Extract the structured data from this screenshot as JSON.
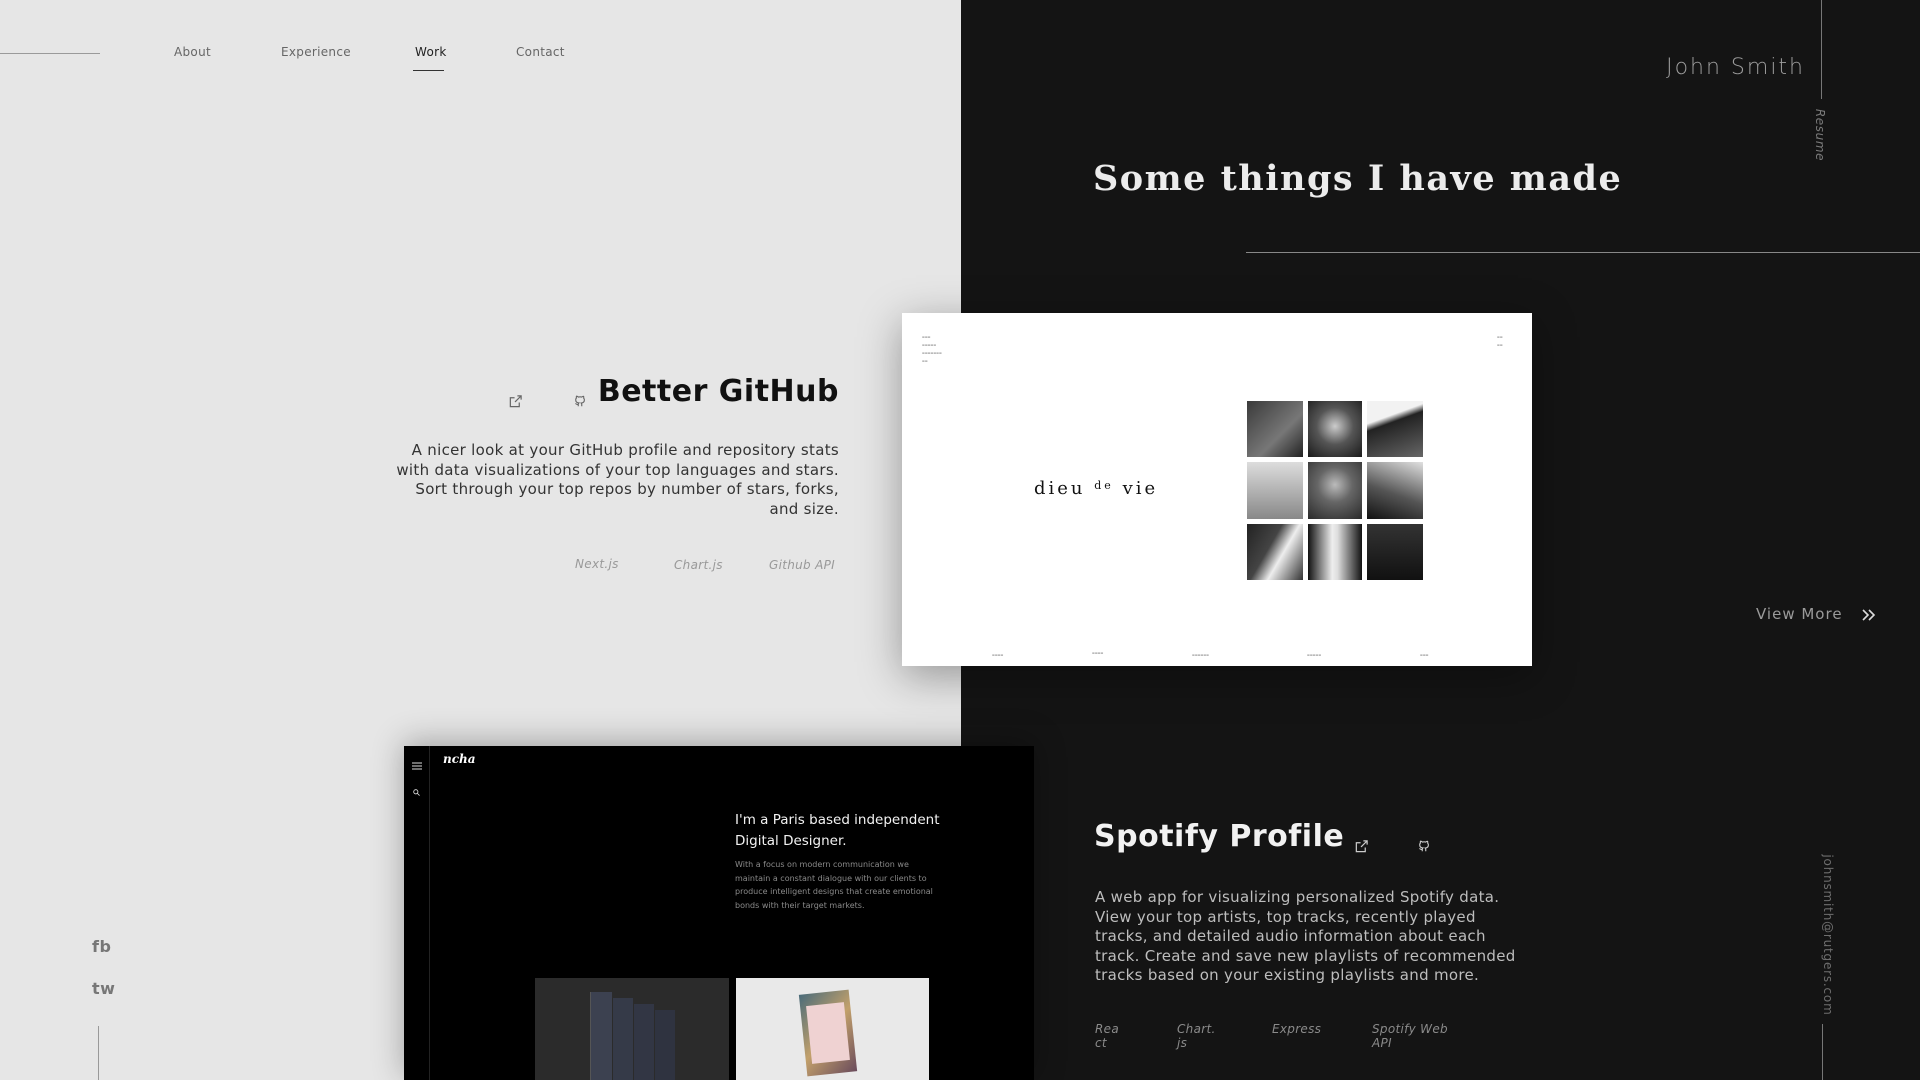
{
  "nav": {
    "items": [
      {
        "label": "About"
      },
      {
        "label": "Experience"
      },
      {
        "label": "Work",
        "active": true
      },
      {
        "label": "Contact"
      }
    ]
  },
  "header": {
    "name": "John Smith",
    "resume_label": "Resume",
    "section_title": "Some things I have made"
  },
  "projects": [
    {
      "title": "Better GitHub",
      "description": "A nicer look at your GitHub profile and repository stats with data visualizations of your top languages and stars. Sort through your top repos by number of stars, forks, and size.",
      "tech": [
        "Next.js",
        "Chart.js",
        "Github API"
      ],
      "icons": [
        "external-link-icon",
        "github-icon"
      ]
    },
    {
      "title": "Spotify Profile",
      "description": "A web app for visualizing personalized Spotify data. View your top artists, top tracks, recently played tracks, and detailed audio information about each track. Create and save new playlists of recommended tracks based on your existing playlists and more.",
      "tech": [
        "React",
        "Chart.js",
        "Express",
        "Spotify Web API"
      ],
      "icons": [
        "external-link-icon",
        "github-icon"
      ]
    }
  ],
  "mockups": {
    "dieu": {
      "logo_main": "dieu",
      "logo_small": "de",
      "logo_end": "vie"
    },
    "ncha": {
      "logo": "ncha",
      "headline": "I'm a Paris based independent Digital Designer.",
      "subtext": "With a focus on modern communication we maintain a constant dialogue with our clients to produce intelligent designs that create emotional bonds with their target markets."
    }
  },
  "view_more": "View More",
  "social": {
    "facebook": "fb",
    "twitter": "tw"
  },
  "email": "johnsmith@rutgers.com",
  "colors": {
    "light_bg": "#e6e6e6",
    "dark_bg": "#141414"
  }
}
